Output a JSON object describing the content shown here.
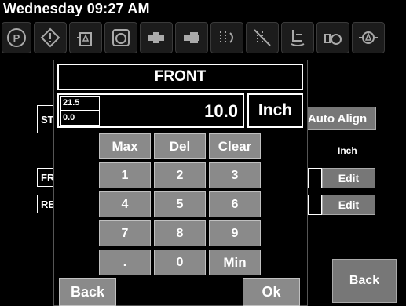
{
  "status": {
    "datetime": "Wednesday 09:27 AM"
  },
  "toolbar": {
    "icons": [
      "parking-icon",
      "warning-icon",
      "tank-icon",
      "gauge-icon",
      "hitch-icon",
      "hitch-icon",
      "sections-icon",
      "no-spray-icon",
      "hand-spray-icon",
      "flow-icon",
      "nozzle-icon"
    ]
  },
  "background": {
    "row1_label": "STA",
    "row2_label": "FRO",
    "row3_label": "REA",
    "auto_align": "Auto Align",
    "unit": "Inch",
    "edit1": "Edit",
    "edit2": "Edit",
    "back": "Back"
  },
  "keypad": {
    "title": "FRONT",
    "value": "10.0",
    "unit": "Inch",
    "max_limit": "21.5",
    "min_limit": "0.0",
    "rows": [
      [
        "Max",
        "Del",
        "Clear"
      ],
      [
        "1",
        "2",
        "3"
      ],
      [
        "4",
        "5",
        "6"
      ],
      [
        "7",
        "8",
        "9"
      ],
      [
        ".",
        "0",
        "Min"
      ]
    ],
    "back": "Back",
    "ok": "Ok"
  },
  "colors": {
    "key": "#8a8a8a",
    "background": "#000000",
    "text": "#ffffff"
  }
}
